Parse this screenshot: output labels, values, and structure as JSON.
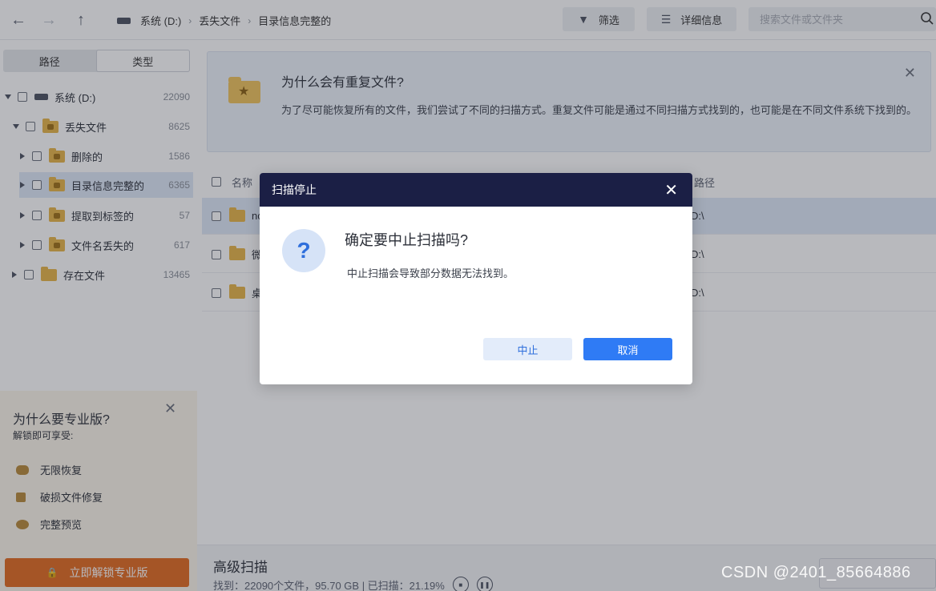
{
  "toolbar": {
    "back_icon": "arrow-left-icon",
    "forward_icon": "arrow-right-icon",
    "up_icon": "arrow-up-icon",
    "breadcrumb": [
      "系统 (D:)",
      "丢失文件",
      "目录信息完整的"
    ],
    "filter_label": "筛选",
    "details_label": "详细信息",
    "search_placeholder": "搜索文件或文件夹"
  },
  "sidebar": {
    "tabs": [
      "路径",
      "类型"
    ],
    "active_tab": "类型",
    "tree": [
      {
        "label": "系统 (D:)",
        "count": "22090"
      },
      {
        "label": "丢失文件",
        "count": "8625"
      },
      {
        "label": "删除的",
        "count": "1586"
      },
      {
        "label": "目录信息完整的",
        "count": "6365"
      },
      {
        "label": "提取到标签的",
        "count": "57"
      },
      {
        "label": "文件名丢失的",
        "count": "617"
      },
      {
        "label": "存在文件",
        "count": "13465"
      }
    ],
    "selected_item": "目录信息完整的"
  },
  "promo": {
    "title": "为什么要专业版?",
    "subtitle": "解锁即可享受:",
    "features": [
      "无限恢复",
      "破损文件修复",
      "完整预览"
    ],
    "unlock_label": "立即解锁专业版"
  },
  "tip": {
    "title": "为什么会有重复文件?",
    "text": "为了尽可能恢复所有的文件，我们尝试了不同的扫描方式。重复文件可能是通过不同扫描方式找到的，也可能是在不同文件系统下找到的。"
  },
  "table": {
    "headers": {
      "name": "名称",
      "path": "路径"
    },
    "rows": [
      {
        "name": "nc",
        "path": "D:\\"
      },
      {
        "name": "微",
        "path": "D:\\"
      },
      {
        "name": "桌",
        "path": "D:\\"
      }
    ]
  },
  "status": {
    "title": "高级扫描",
    "line": "找到：22090个文件，95.70 GB | 已扫描：21.19%"
  },
  "dialog": {
    "header": "扫描停止",
    "title": "确定要中止扫描吗?",
    "message": "中止扫描会导致部分数据无法找到。",
    "abort_label": "中止",
    "cancel_label": "取消"
  },
  "watermark": "CSDN @2401_85664886",
  "colors": {
    "accent": "#2f7bf5",
    "dialog_header": "#1b1f45",
    "unlock": "#e36a1f",
    "folder": "#e8b547"
  }
}
